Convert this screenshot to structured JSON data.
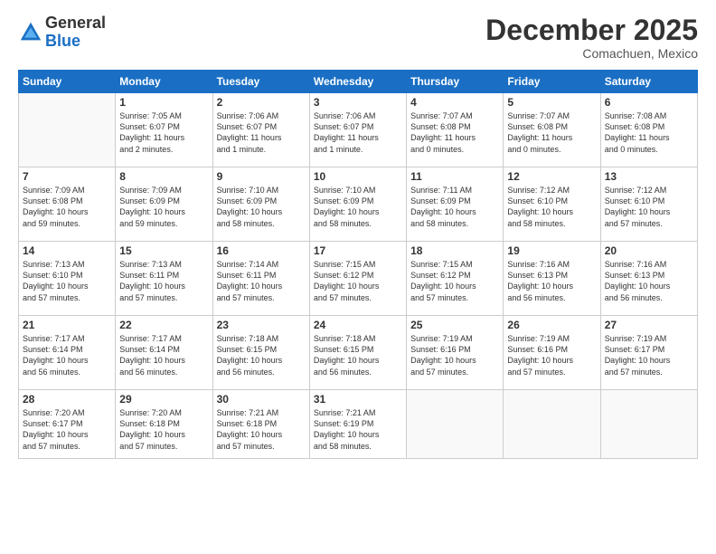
{
  "logo": {
    "general": "General",
    "blue": "Blue"
  },
  "title": "December 2025",
  "subtitle": "Comachuen, Mexico",
  "days_of_week": [
    "Sunday",
    "Monday",
    "Tuesday",
    "Wednesday",
    "Thursday",
    "Friday",
    "Saturday"
  ],
  "weeks": [
    [
      {
        "day": "",
        "info": ""
      },
      {
        "day": "1",
        "info": "Sunrise: 7:05 AM\nSunset: 6:07 PM\nDaylight: 11 hours\nand 2 minutes."
      },
      {
        "day": "2",
        "info": "Sunrise: 7:06 AM\nSunset: 6:07 PM\nDaylight: 11 hours\nand 1 minute."
      },
      {
        "day": "3",
        "info": "Sunrise: 7:06 AM\nSunset: 6:07 PM\nDaylight: 11 hours\nand 1 minute."
      },
      {
        "day": "4",
        "info": "Sunrise: 7:07 AM\nSunset: 6:08 PM\nDaylight: 11 hours\nand 0 minutes."
      },
      {
        "day": "5",
        "info": "Sunrise: 7:07 AM\nSunset: 6:08 PM\nDaylight: 11 hours\nand 0 minutes."
      },
      {
        "day": "6",
        "info": "Sunrise: 7:08 AM\nSunset: 6:08 PM\nDaylight: 11 hours\nand 0 minutes."
      }
    ],
    [
      {
        "day": "7",
        "info": "Sunrise: 7:09 AM\nSunset: 6:08 PM\nDaylight: 10 hours\nand 59 minutes."
      },
      {
        "day": "8",
        "info": "Sunrise: 7:09 AM\nSunset: 6:09 PM\nDaylight: 10 hours\nand 59 minutes."
      },
      {
        "day": "9",
        "info": "Sunrise: 7:10 AM\nSunset: 6:09 PM\nDaylight: 10 hours\nand 58 minutes."
      },
      {
        "day": "10",
        "info": "Sunrise: 7:10 AM\nSunset: 6:09 PM\nDaylight: 10 hours\nand 58 minutes."
      },
      {
        "day": "11",
        "info": "Sunrise: 7:11 AM\nSunset: 6:09 PM\nDaylight: 10 hours\nand 58 minutes."
      },
      {
        "day": "12",
        "info": "Sunrise: 7:12 AM\nSunset: 6:10 PM\nDaylight: 10 hours\nand 58 minutes."
      },
      {
        "day": "13",
        "info": "Sunrise: 7:12 AM\nSunset: 6:10 PM\nDaylight: 10 hours\nand 57 minutes."
      }
    ],
    [
      {
        "day": "14",
        "info": "Sunrise: 7:13 AM\nSunset: 6:10 PM\nDaylight: 10 hours\nand 57 minutes."
      },
      {
        "day": "15",
        "info": "Sunrise: 7:13 AM\nSunset: 6:11 PM\nDaylight: 10 hours\nand 57 minutes."
      },
      {
        "day": "16",
        "info": "Sunrise: 7:14 AM\nSunset: 6:11 PM\nDaylight: 10 hours\nand 57 minutes."
      },
      {
        "day": "17",
        "info": "Sunrise: 7:15 AM\nSunset: 6:12 PM\nDaylight: 10 hours\nand 57 minutes."
      },
      {
        "day": "18",
        "info": "Sunrise: 7:15 AM\nSunset: 6:12 PM\nDaylight: 10 hours\nand 57 minutes."
      },
      {
        "day": "19",
        "info": "Sunrise: 7:16 AM\nSunset: 6:13 PM\nDaylight: 10 hours\nand 56 minutes."
      },
      {
        "day": "20",
        "info": "Sunrise: 7:16 AM\nSunset: 6:13 PM\nDaylight: 10 hours\nand 56 minutes."
      }
    ],
    [
      {
        "day": "21",
        "info": "Sunrise: 7:17 AM\nSunset: 6:14 PM\nDaylight: 10 hours\nand 56 minutes."
      },
      {
        "day": "22",
        "info": "Sunrise: 7:17 AM\nSunset: 6:14 PM\nDaylight: 10 hours\nand 56 minutes."
      },
      {
        "day": "23",
        "info": "Sunrise: 7:18 AM\nSunset: 6:15 PM\nDaylight: 10 hours\nand 56 minutes."
      },
      {
        "day": "24",
        "info": "Sunrise: 7:18 AM\nSunset: 6:15 PM\nDaylight: 10 hours\nand 56 minutes."
      },
      {
        "day": "25",
        "info": "Sunrise: 7:19 AM\nSunset: 6:16 PM\nDaylight: 10 hours\nand 57 minutes."
      },
      {
        "day": "26",
        "info": "Sunrise: 7:19 AM\nSunset: 6:16 PM\nDaylight: 10 hours\nand 57 minutes."
      },
      {
        "day": "27",
        "info": "Sunrise: 7:19 AM\nSunset: 6:17 PM\nDaylight: 10 hours\nand 57 minutes."
      }
    ],
    [
      {
        "day": "28",
        "info": "Sunrise: 7:20 AM\nSunset: 6:17 PM\nDaylight: 10 hours\nand 57 minutes."
      },
      {
        "day": "29",
        "info": "Sunrise: 7:20 AM\nSunset: 6:18 PM\nDaylight: 10 hours\nand 57 minutes."
      },
      {
        "day": "30",
        "info": "Sunrise: 7:21 AM\nSunset: 6:18 PM\nDaylight: 10 hours\nand 57 minutes."
      },
      {
        "day": "31",
        "info": "Sunrise: 7:21 AM\nSunset: 6:19 PM\nDaylight: 10 hours\nand 58 minutes."
      },
      {
        "day": "",
        "info": ""
      },
      {
        "day": "",
        "info": ""
      },
      {
        "day": "",
        "info": ""
      }
    ]
  ]
}
